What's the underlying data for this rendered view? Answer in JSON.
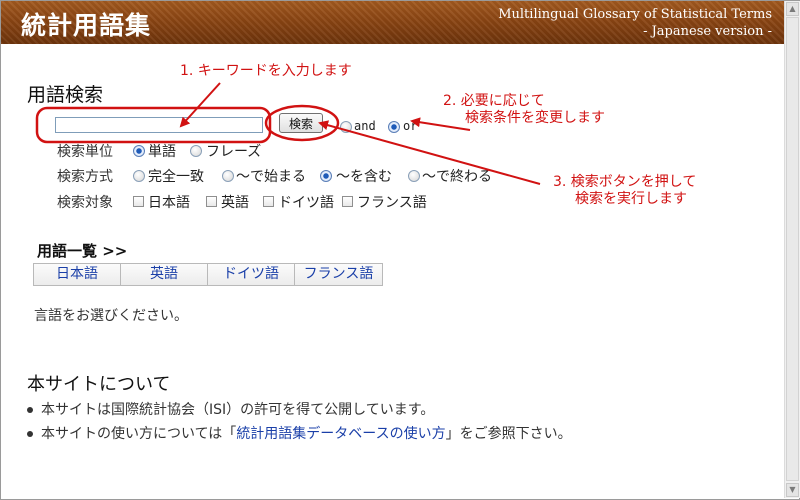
{
  "header": {
    "title": "統計用語集",
    "subtitle_en": "Multilingual Glossary of Statistical Terms",
    "version": "- Japanese version -"
  },
  "search": {
    "heading": "用語検索",
    "input_value": "",
    "button_label": "検索",
    "logic_options": [
      {
        "label": "and",
        "checked": false
      },
      {
        "label": "or",
        "checked": true
      }
    ],
    "unit": {
      "label": "検索単位",
      "options": [
        {
          "label": "単語",
          "checked": true
        },
        {
          "label": "フレーズ",
          "checked": false
        }
      ]
    },
    "method": {
      "label": "検索方式",
      "options": [
        {
          "label": "完全一致",
          "checked": false
        },
        {
          "label": "～で始まる",
          "checked": false
        },
        {
          "label": "～を含む",
          "checked": true
        },
        {
          "label": "～で終わる",
          "checked": false
        }
      ]
    },
    "target": {
      "label": "検索対象",
      "options": [
        {
          "label": "日本語",
          "checked": false
        },
        {
          "label": "英語",
          "checked": false
        },
        {
          "label": "ドイツ語",
          "checked": false
        },
        {
          "label": "フランス語",
          "checked": false
        }
      ]
    }
  },
  "annotations": {
    "step1": "1. キーワードを入力します",
    "step2_line1": "2. 必要に応じて",
    "step2_line2": "検索条件を変更します",
    "step3_line1": "3. 検索ボタンを押して",
    "step3_line2": "検索を実行します",
    "color": "#d11212"
  },
  "glossary": {
    "heading": "用語一覧 >>",
    "tabs": [
      "日本語",
      "英語",
      "ドイツ語",
      "フランス語"
    ],
    "message": "言語をお選びください。"
  },
  "about": {
    "heading": "本サイトについて",
    "bullet1": "本サイトは国際統計協会（ISI）の許可を得て公開しています。",
    "bullet2_prefix": "本サイトの使い方については「",
    "bullet2_link": "統計用語集データベースの使い方",
    "bullet2_suffix": "」をご参照下さい。"
  },
  "colors": {
    "header_brown": "#8b4513",
    "link_blue": "#1a3fa8",
    "annotation_red": "#d11212"
  }
}
